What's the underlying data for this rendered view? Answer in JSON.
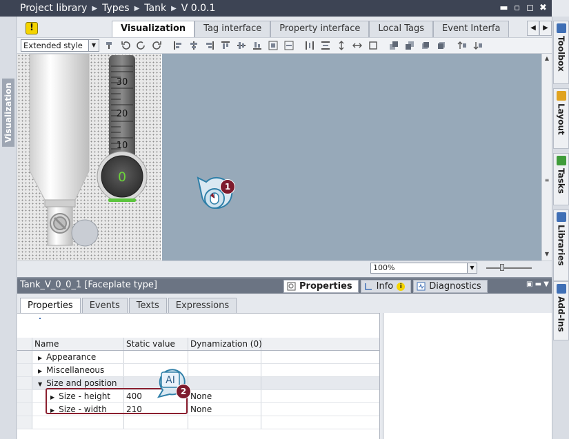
{
  "breadcrumb": [
    "Project library",
    "Types",
    "Tank",
    "V 0.0.1"
  ],
  "window_buttons": [
    "▬",
    "▫",
    "◻",
    "✖"
  ],
  "left_strip_label": "Visualization",
  "editor_tabs": [
    {
      "label": "Visualization",
      "active": true
    },
    {
      "label": "Tag interface",
      "active": false
    },
    {
      "label": "Property interface",
      "active": false
    },
    {
      "label": "Local Tags",
      "active": false
    },
    {
      "label": "Event Interfa",
      "active": false
    }
  ],
  "tab_nav": [
    "◀",
    "▶"
  ],
  "style_select": {
    "value": "Extended style",
    "arrow": "▼"
  },
  "faceplate": {
    "scale": [
      "30",
      "20",
      "10"
    ],
    "gauge_value": "0"
  },
  "zoom": {
    "value": "100%",
    "arrow": "▼"
  },
  "right_tabs": [
    "Toolbox",
    "Layout",
    "Tasks",
    "Libraries",
    "Add-Ins"
  ],
  "inspector": {
    "title": "Tank_V_0_0_1 [Faceplate type]",
    "tabs": [
      {
        "label": "Properties",
        "active": true
      },
      {
        "label": "Info",
        "active": false
      },
      {
        "label": "Diagnostics",
        "active": false
      }
    ],
    "sub_tabs": [
      {
        "label": "Properties",
        "active": true
      },
      {
        "label": "Events",
        "active": false
      },
      {
        "label": "Texts",
        "active": false
      },
      {
        "label": "Expressions",
        "active": false
      }
    ],
    "grid_headers": [
      "Name",
      "Static value",
      "Dynamization (0)"
    ],
    "rows": [
      {
        "name": "Appearance",
        "static": "",
        "dyn": "",
        "expanded": false,
        "indent": 1
      },
      {
        "name": "Miscellaneous",
        "static": "",
        "dyn": "",
        "expanded": false,
        "indent": 1
      },
      {
        "name": "Size and position",
        "static": "",
        "dyn": "",
        "expanded": true,
        "indent": 1
      },
      {
        "name": "Size - height",
        "static": "400",
        "dyn": "None",
        "expanded": false,
        "indent": 2
      },
      {
        "name": "Size - width",
        "static": "210",
        "dyn": "None",
        "expanded": false,
        "indent": 2
      }
    ]
  },
  "callouts": [
    "1",
    "2"
  ],
  "ai_badge": "AI",
  "colors": {
    "accent": "#7e1b2d",
    "canvas": "#97a9b9",
    "titlebar": "#3d4454"
  }
}
